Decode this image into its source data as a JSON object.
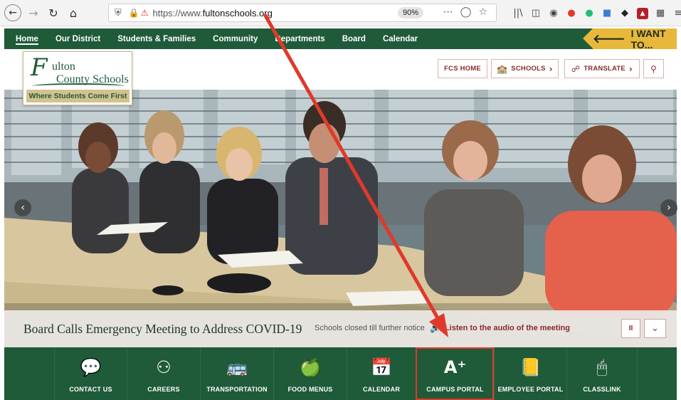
{
  "browser": {
    "url_prefix": "https://www.",
    "url_domain": "fultonschools.org",
    "zoom": "90%",
    "back_icon": "back-arrow",
    "forward_icon": "forward-arrow"
  },
  "nav": {
    "items": [
      {
        "label": "Home",
        "active": true
      },
      {
        "label": "Our District"
      },
      {
        "label": "Students & Families"
      },
      {
        "label": "Community"
      },
      {
        "label": "Departments"
      },
      {
        "label": "Board"
      },
      {
        "label": "Calendar"
      }
    ],
    "want_label": "I WANT TO..."
  },
  "logo": {
    "initial": "F",
    "line1": "ulton",
    "line2": "County Schools",
    "tagline": "Where Students Come First"
  },
  "header_buttons": {
    "fcs_home": "FCS HOME",
    "schools": "SCHOOLS",
    "translate": "TRANSLATE"
  },
  "hero": {
    "title": "Board Calls Emergency Meeting to Address COVID-19",
    "notice": "Schools closed till further notice",
    "audio_link": "Listen to the audio of the meeting",
    "pause_label": "II"
  },
  "quick_links": [
    {
      "label": "CONTACT US",
      "icon": "chat-phone-icon"
    },
    {
      "label": "CAREERS",
      "icon": "people-icon"
    },
    {
      "label": "TRANSPORTATION",
      "icon": "bus-icon"
    },
    {
      "label": "FOOD MENUS",
      "icon": "apple-tablet-icon"
    },
    {
      "label": "CALENDAR",
      "icon": "calendar-icon"
    },
    {
      "label": "CAMPUS PORTAL",
      "icon": "a-plus-icon",
      "highlighted": true
    },
    {
      "label": "EMPLOYEE PORTAL",
      "icon": "contact-book-icon"
    },
    {
      "label": "CLASSLINK",
      "icon": "browser-cursor-icon"
    }
  ],
  "colors": {
    "brand_green": "#1f5a39",
    "accent_gold": "#e8b83a",
    "accent_maroon": "#8a2a2a",
    "annotation_red": "#e0392b"
  }
}
